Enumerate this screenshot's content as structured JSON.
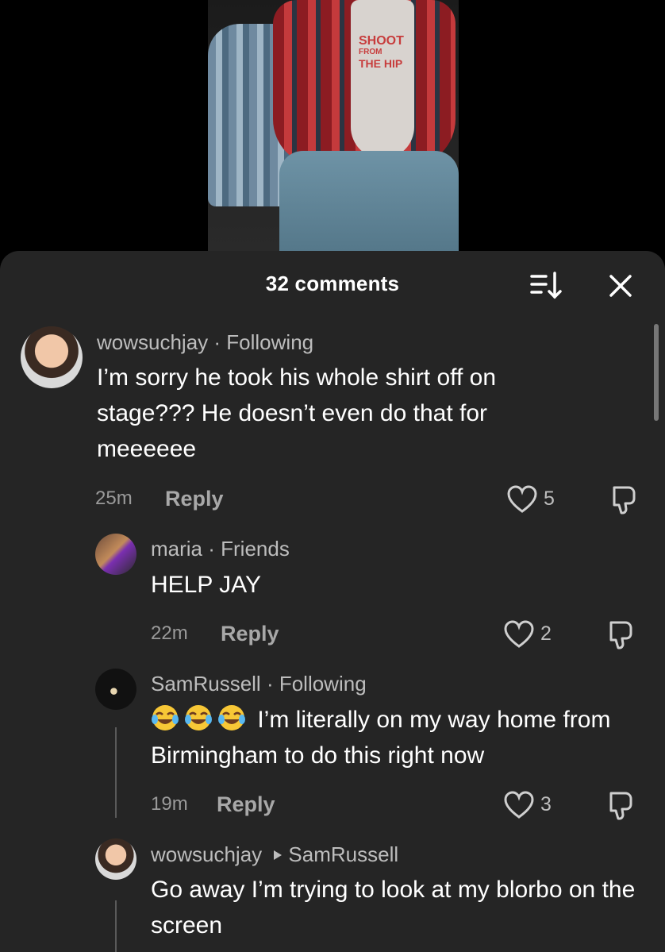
{
  "video": {
    "overlay_text": [
      "SHOOT",
      "FROM",
      "THE HIP"
    ]
  },
  "sheet": {
    "title": "32 comments"
  },
  "comments": [
    {
      "username": "wowsuchjay",
      "relation": "Following",
      "text": "I’m sorry he took his whole shirt off on stage??? He doesn’t even do that for meeeeee",
      "time": "25m",
      "reply_label": "Reply",
      "likes": "5"
    },
    {
      "username": "maria",
      "relation": "Friends",
      "text": "HELP JAY",
      "time": "22m",
      "reply_label": "Reply",
      "likes": "2"
    },
    {
      "username": "SamRussell",
      "relation": "Following",
      "text": "I’m literally on my way home from Birmingham to do this right now",
      "time": "19m",
      "reply_label": "Reply",
      "likes": "3"
    },
    {
      "username": "wowsuchjay",
      "reply_to": "SamRussell",
      "text": "Go away I’m trying to look at my blorbo on the screen"
    }
  ],
  "separator": " · ",
  "colors": {
    "sheet_bg": "#252525",
    "muted": "#bdbdbd",
    "text": "#ffffff"
  },
  "icons": [
    "sort-icon",
    "close-icon",
    "heart-icon",
    "dislike-icon",
    "tears-of-joy-emoji",
    "reply-arrow-icon"
  ]
}
